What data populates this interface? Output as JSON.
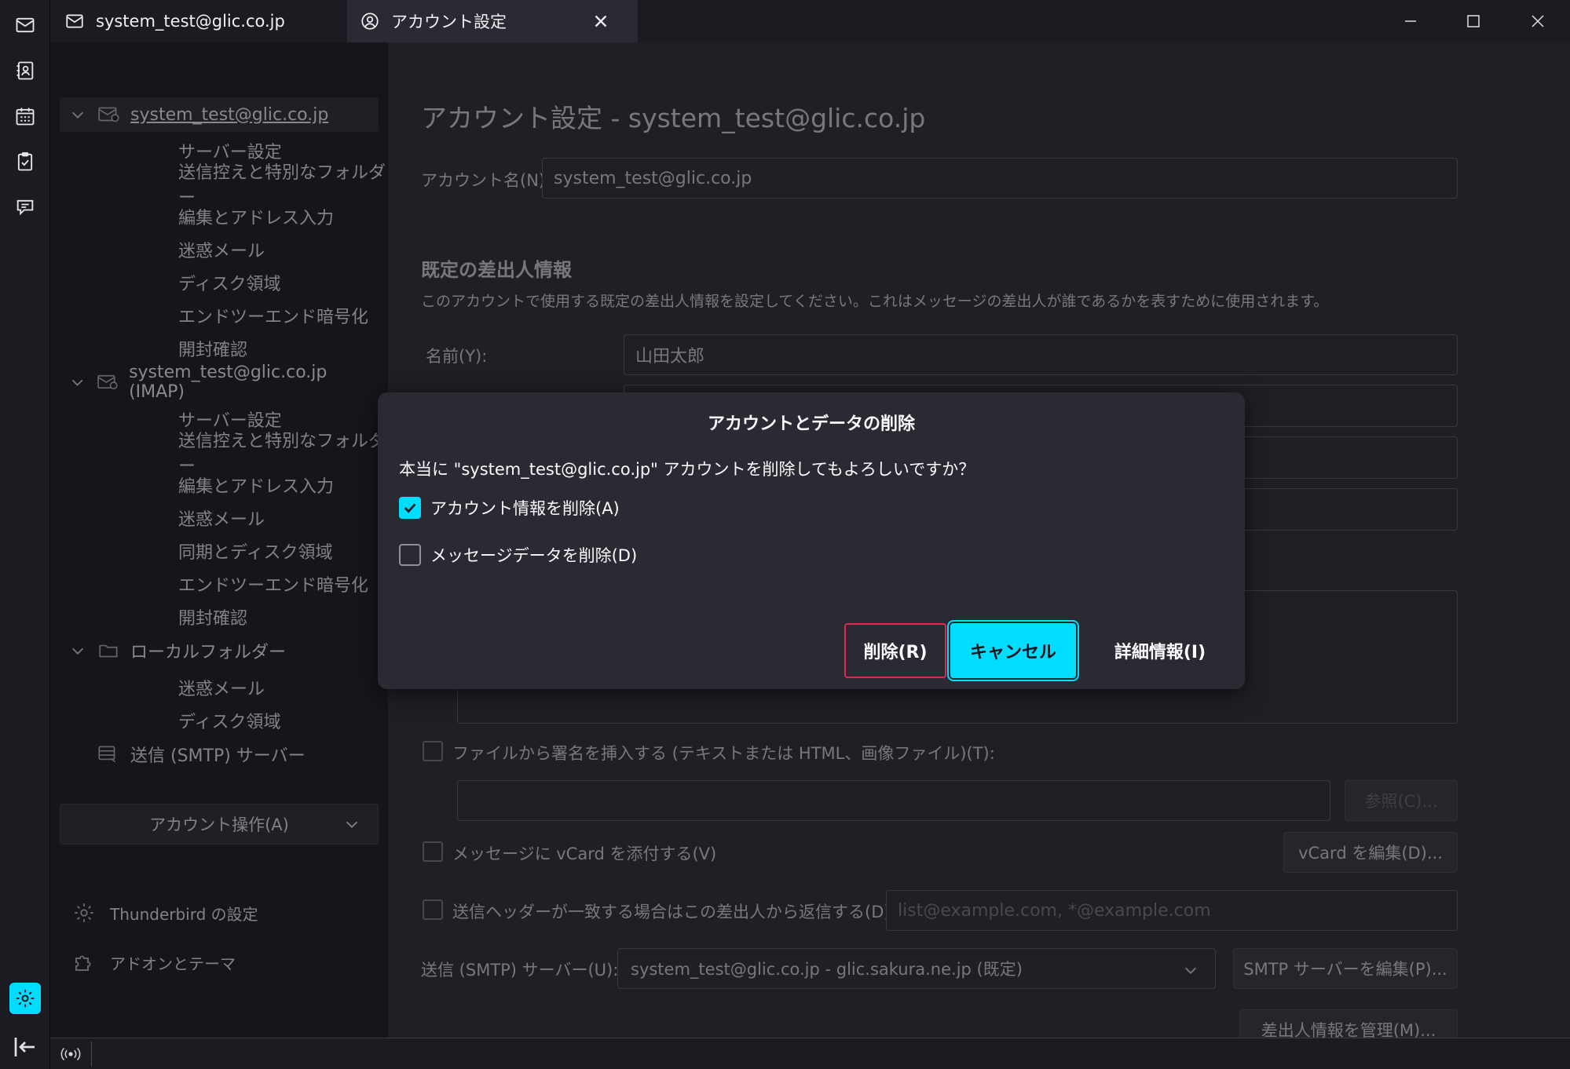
{
  "tabs": [
    {
      "label": "system_test@glic.co.jp",
      "icon": "mail-icon"
    },
    {
      "label": "アカウント設定",
      "icon": "account-icon"
    }
  ],
  "sidebar": {
    "accounts": [
      {
        "label": "system_test@glic.co.jp",
        "children": [
          "サーバー設定",
          "送信控えと特別なフォルダー",
          "編集とアドレス入力",
          "迷惑メール",
          "ディスク領域",
          "エンドツーエンド暗号化",
          "開封確認"
        ]
      },
      {
        "label": "system_test@glic.co.jp (IMAP)",
        "children": [
          "サーバー設定",
          "送信控えと特別なフォルダー",
          "編集とアドレス入力",
          "迷惑メール",
          "同期とディスク領域",
          "エンドツーエンド暗号化",
          "開封確認"
        ]
      },
      {
        "label": "ローカルフォルダー",
        "children": [
          "迷惑メール",
          "ディスク領域"
        ]
      }
    ],
    "smtp_label": "送信 (SMTP) サーバー",
    "account_actions": "アカウント操作(A)",
    "settings_link": "Thunderbird の設定",
    "addons_link": "アドオンとテーマ"
  },
  "main": {
    "title": "アカウント設定 - system_test@glic.co.jp",
    "account_name_label": "アカウント名(N):",
    "account_name_value": "system_test@glic.co.jp",
    "identity_heading": "既定の差出人情報",
    "identity_desc": "このアカウントで使用する既定の差出人情報を設定してください。これはメッセージの差出人が誰であるかを表すために使用されます。",
    "name_label": "名前(Y):",
    "name_value": "山田太郎",
    "sig_file_label": "ファイルから署名を挿入する (テキストまたは HTML、画像ファイル)(T):",
    "browse_button": "参照(C)...",
    "vcard_label": "メッセージに vCard を添付する(V)",
    "vcard_button": "vCard を編集(D)...",
    "reply_from_label": "送信ヘッダーが一致する場合はこの差出人から返信する(D):",
    "reply_from_placeholder": "list@example.com, *@example.com",
    "smtp_label": "送信 (SMTP) サーバー(U):",
    "smtp_value": "system_test@glic.co.jp - glic.sakura.ne.jp (既定)",
    "smtp_edit_button": "SMTP サーバーを編集(P)...",
    "manage_identities_button": "差出人情報を管理(M)..."
  },
  "dialog": {
    "title": "アカウントとデータの削除",
    "message": "本当に \"system_test@glic.co.jp\" アカウントを削除してもよろしいですか？",
    "checkbox_account_info": "アカウント情報を削除(A)",
    "checkbox_account_info_checked": true,
    "checkbox_message_data": "メッセージデータを削除(D)",
    "checkbox_message_data_checked": false,
    "delete_button": "削除(R)",
    "cancel_button": "キャンセル",
    "details_button": "詳細情報(I)"
  },
  "colors": {
    "accent": "#00ddff",
    "danger": "#e22850",
    "background": "#1c1b22",
    "surface": "#2b2a33"
  }
}
